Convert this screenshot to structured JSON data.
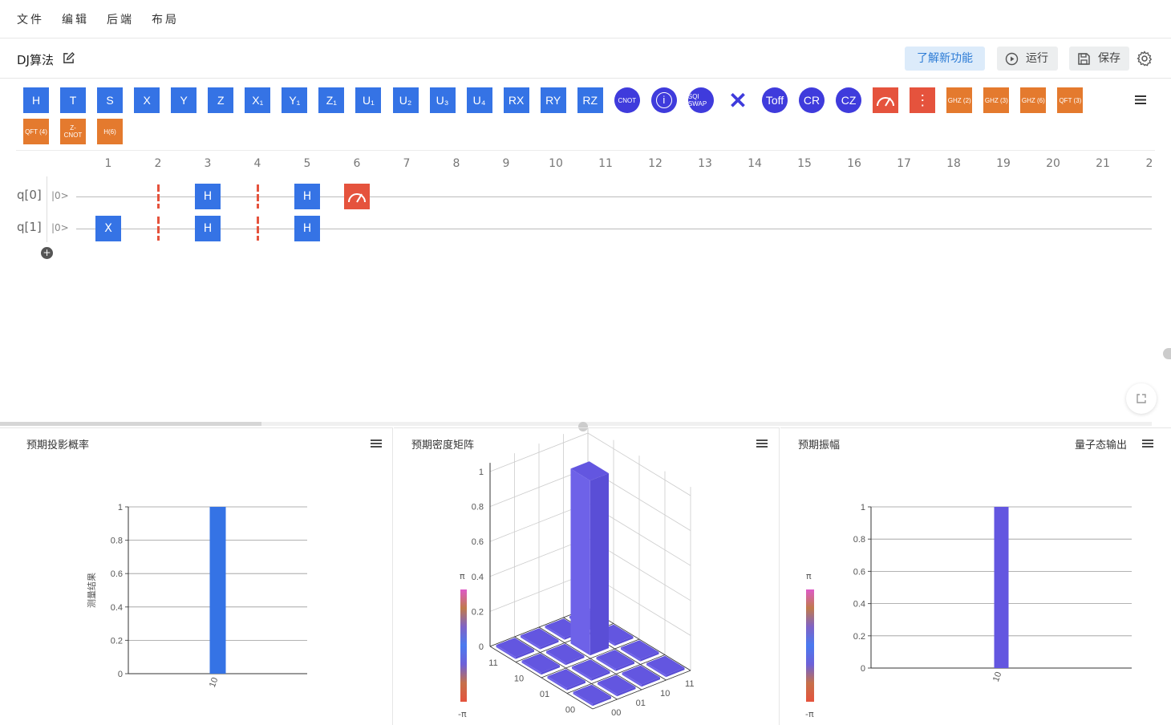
{
  "menu": {
    "items": [
      "文件",
      "编辑",
      "后端",
      "布局"
    ]
  },
  "titlebar": {
    "project_title": "DJ算法",
    "learn_label": "了解新功能",
    "run_label": "运行",
    "save_label": "保存"
  },
  "palette": {
    "row1": [
      {
        "label": "H",
        "kind": "square",
        "name": "h"
      },
      {
        "label": "T",
        "kind": "square",
        "name": "t"
      },
      {
        "label": "S",
        "kind": "square",
        "name": "s"
      },
      {
        "label": "X",
        "kind": "square",
        "name": "x"
      },
      {
        "label": "Y",
        "kind": "square",
        "name": "y"
      },
      {
        "label": "Z",
        "kind": "square",
        "name": "z"
      },
      {
        "label": "X₁",
        "kind": "square",
        "name": "x1"
      },
      {
        "label": "Y₁",
        "kind": "square",
        "name": "y1"
      },
      {
        "label": "Z₁",
        "kind": "square",
        "name": "z1"
      },
      {
        "label": "U₁",
        "kind": "square",
        "name": "u1"
      },
      {
        "label": "U₂",
        "kind": "square",
        "name": "u2"
      },
      {
        "label": "U₃",
        "kind": "square",
        "name": "u3"
      },
      {
        "label": "U₄",
        "kind": "square",
        "name": "u4"
      },
      {
        "label": "RX",
        "kind": "square",
        "name": "rx"
      },
      {
        "label": "RY",
        "kind": "square",
        "name": "ry"
      },
      {
        "label": "RZ",
        "kind": "square",
        "name": "rz"
      },
      {
        "label": "CNOT",
        "kind": "circle",
        "name": "cnot"
      },
      {
        "label": "i",
        "kind": "circle",
        "name": "iswap"
      },
      {
        "label": "SQI SWAP",
        "kind": "circle",
        "name": "sqiswap"
      },
      {
        "label": "✕",
        "kind": "plain",
        "name": "swap"
      },
      {
        "label": "Toff",
        "kind": "circle",
        "name": "toffoli"
      },
      {
        "label": "CR",
        "kind": "circle",
        "name": "cr"
      },
      {
        "label": "CZ",
        "kind": "circle",
        "name": "cz"
      },
      {
        "label": "",
        "kind": "red",
        "name": "measure"
      },
      {
        "label": "⋮",
        "kind": "red",
        "name": "barrier"
      },
      {
        "label": "GHZ (2)",
        "kind": "orange",
        "name": "ghz2"
      },
      {
        "label": "GHZ (3)",
        "kind": "orange",
        "name": "ghz3"
      },
      {
        "label": "GHZ (6)",
        "kind": "orange",
        "name": "ghz6"
      },
      {
        "label": "QFT (3)",
        "kind": "orange",
        "name": "qft3"
      }
    ],
    "row2": [
      {
        "label": "QFT (4)",
        "kind": "orange",
        "name": "qft4"
      },
      {
        "label": "Z- CNOT",
        "kind": "orange",
        "name": "zcnot"
      },
      {
        "label": "H(6)",
        "kind": "orange",
        "name": "h6"
      }
    ]
  },
  "circuit": {
    "columns": [
      "1",
      "2",
      "3",
      "4",
      "5",
      "6",
      "7",
      "8",
      "9",
      "10",
      "11",
      "12",
      "13",
      "14",
      "15",
      "16",
      "17",
      "18",
      "19",
      "20",
      "21",
      "2"
    ],
    "qubits": [
      {
        "label": "q[0]",
        "init": "|0>"
      },
      {
        "label": "q[1]",
        "init": "|0>"
      }
    ],
    "gates": [
      {
        "q": 1,
        "col": 1,
        "label": "X",
        "type": "gate"
      },
      {
        "q": 0,
        "col": 2,
        "label": "",
        "type": "barrier"
      },
      {
        "q": 1,
        "col": 2,
        "label": "",
        "type": "barrier"
      },
      {
        "q": 0,
        "col": 3,
        "label": "H",
        "type": "gate"
      },
      {
        "q": 1,
        "col": 3,
        "label": "H",
        "type": "gate"
      },
      {
        "q": 0,
        "col": 4,
        "label": "",
        "type": "barrier"
      },
      {
        "q": 1,
        "col": 4,
        "label": "",
        "type": "barrier"
      },
      {
        "q": 0,
        "col": 5,
        "label": "H",
        "type": "gate"
      },
      {
        "q": 1,
        "col": 5,
        "label": "H",
        "type": "gate"
      },
      {
        "q": 0,
        "col": 6,
        "label": "",
        "type": "measure"
      }
    ]
  },
  "panels": {
    "prob": {
      "title": "预期投影概率"
    },
    "density": {
      "title": "预期密度矩阵",
      "pi_top": "π",
      "pi_bottom": "-π"
    },
    "amp": {
      "title": "预期振幅",
      "link": "量子态输出",
      "pi_top": "π",
      "pi_bottom": "-π"
    }
  },
  "chart_data": [
    {
      "type": "bar",
      "title": "预期投影概率",
      "categories": [
        "10"
      ],
      "values": [
        1
      ],
      "ylabel": "测量结果",
      "ylim": [
        0,
        1
      ],
      "yticks": [
        "0",
        "0.2",
        "0.4",
        "0.6",
        "0.8",
        "1"
      ],
      "color": "#3573e5",
      "grid": true
    },
    {
      "type": "bar3d",
      "title": "预期密度矩阵",
      "rows": [
        "00",
        "01",
        "10",
        "11"
      ],
      "cols": [
        "00",
        "01",
        "10",
        "11"
      ],
      "values": [
        [
          0,
          0,
          0,
          0
        ],
        [
          0,
          0,
          0,
          0
        ],
        [
          0,
          0,
          1,
          0
        ],
        [
          0,
          0,
          0,
          0
        ]
      ],
      "zlim": [
        0,
        1
      ],
      "zticks": [
        "0",
        "0.2",
        "0.4",
        "0.6",
        "0.8",
        "1"
      ],
      "color": "#6356e0"
    },
    {
      "type": "bar",
      "title": "预期振幅",
      "categories": [
        "10"
      ],
      "values": [
        1
      ],
      "ylim": [
        0,
        1
      ],
      "yticks": [
        "0",
        "0.2",
        "0.4",
        "0.6",
        "0.8",
        "1"
      ],
      "color": "#6356e0",
      "grid": true
    }
  ]
}
